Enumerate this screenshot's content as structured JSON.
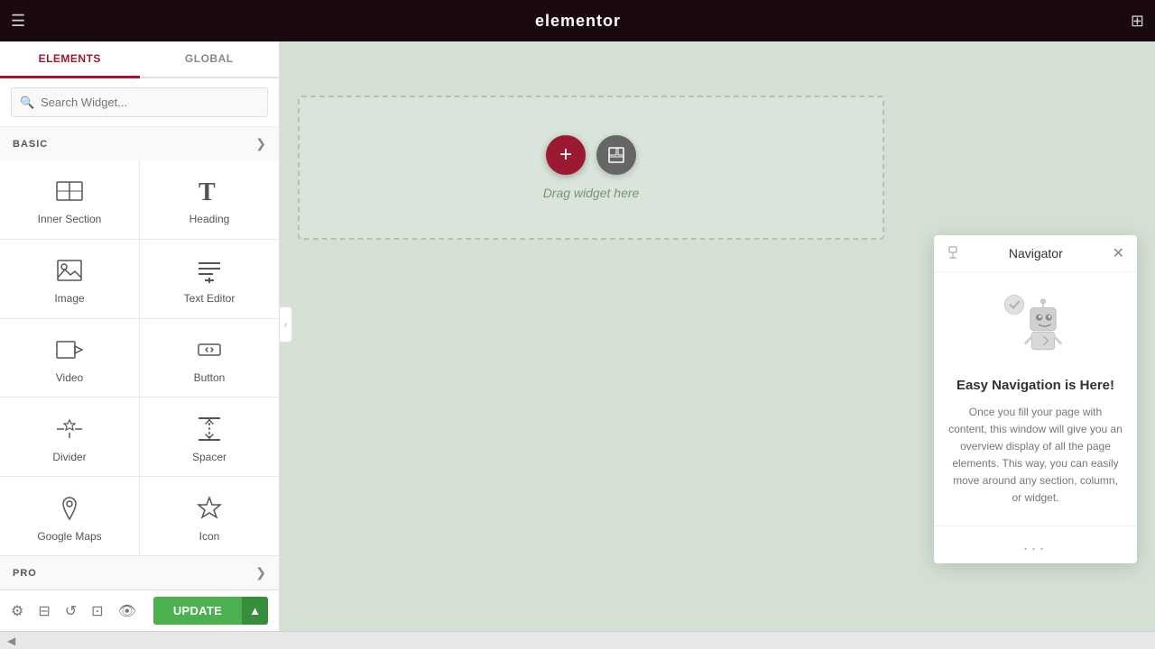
{
  "header": {
    "logo": "elementor",
    "hamburger_icon": "☰",
    "grid_icon": "⊞"
  },
  "sidebar": {
    "tabs": [
      {
        "id": "elements",
        "label": "ELEMENTS",
        "active": true
      },
      {
        "id": "global",
        "label": "GLOBAL",
        "active": false
      }
    ],
    "search": {
      "placeholder": "Search Widget...",
      "value": ""
    },
    "basic_section": {
      "label": "BASIC",
      "collapsed": false
    },
    "widgets": [
      {
        "id": "inner-section",
        "label": "Inner Section",
        "icon": "inner-section-icon"
      },
      {
        "id": "heading",
        "label": "Heading",
        "icon": "heading-icon"
      },
      {
        "id": "image",
        "label": "Image",
        "icon": "image-icon"
      },
      {
        "id": "text-editor",
        "label": "Text Editor",
        "icon": "text-editor-icon"
      },
      {
        "id": "video",
        "label": "Video",
        "icon": "video-icon"
      },
      {
        "id": "button",
        "label": "Button",
        "icon": "button-icon"
      },
      {
        "id": "divider",
        "label": "Divider",
        "icon": "divider-icon"
      },
      {
        "id": "spacer",
        "label": "Spacer",
        "icon": "spacer-icon"
      },
      {
        "id": "google-maps",
        "label": "Google Maps",
        "icon": "google-maps-icon"
      },
      {
        "id": "icon",
        "label": "Icon",
        "icon": "icon-widget-icon"
      }
    ],
    "pro_section": {
      "label": "PRO",
      "collapsed": false
    }
  },
  "toolbar": {
    "settings_icon": "⚙",
    "layers_icon": "⊟",
    "history_icon": "↺",
    "responsive_icon": "⊡",
    "preview_icon": "👁",
    "update_label": "UPDATE",
    "update_arrow": "▲"
  },
  "canvas": {
    "drag_text": "Drag widget here",
    "add_btn": "+",
    "template_btn": "⊡"
  },
  "navigator": {
    "title": "Navigator",
    "pin_icon": "📌",
    "close_icon": "✕",
    "heading": "Easy Navigation is Here!",
    "description": "Once you fill your page with content, this window will give you an overview display of all the page elements. This way, you can easily move around any section, column, or widget.",
    "footer": "..."
  }
}
